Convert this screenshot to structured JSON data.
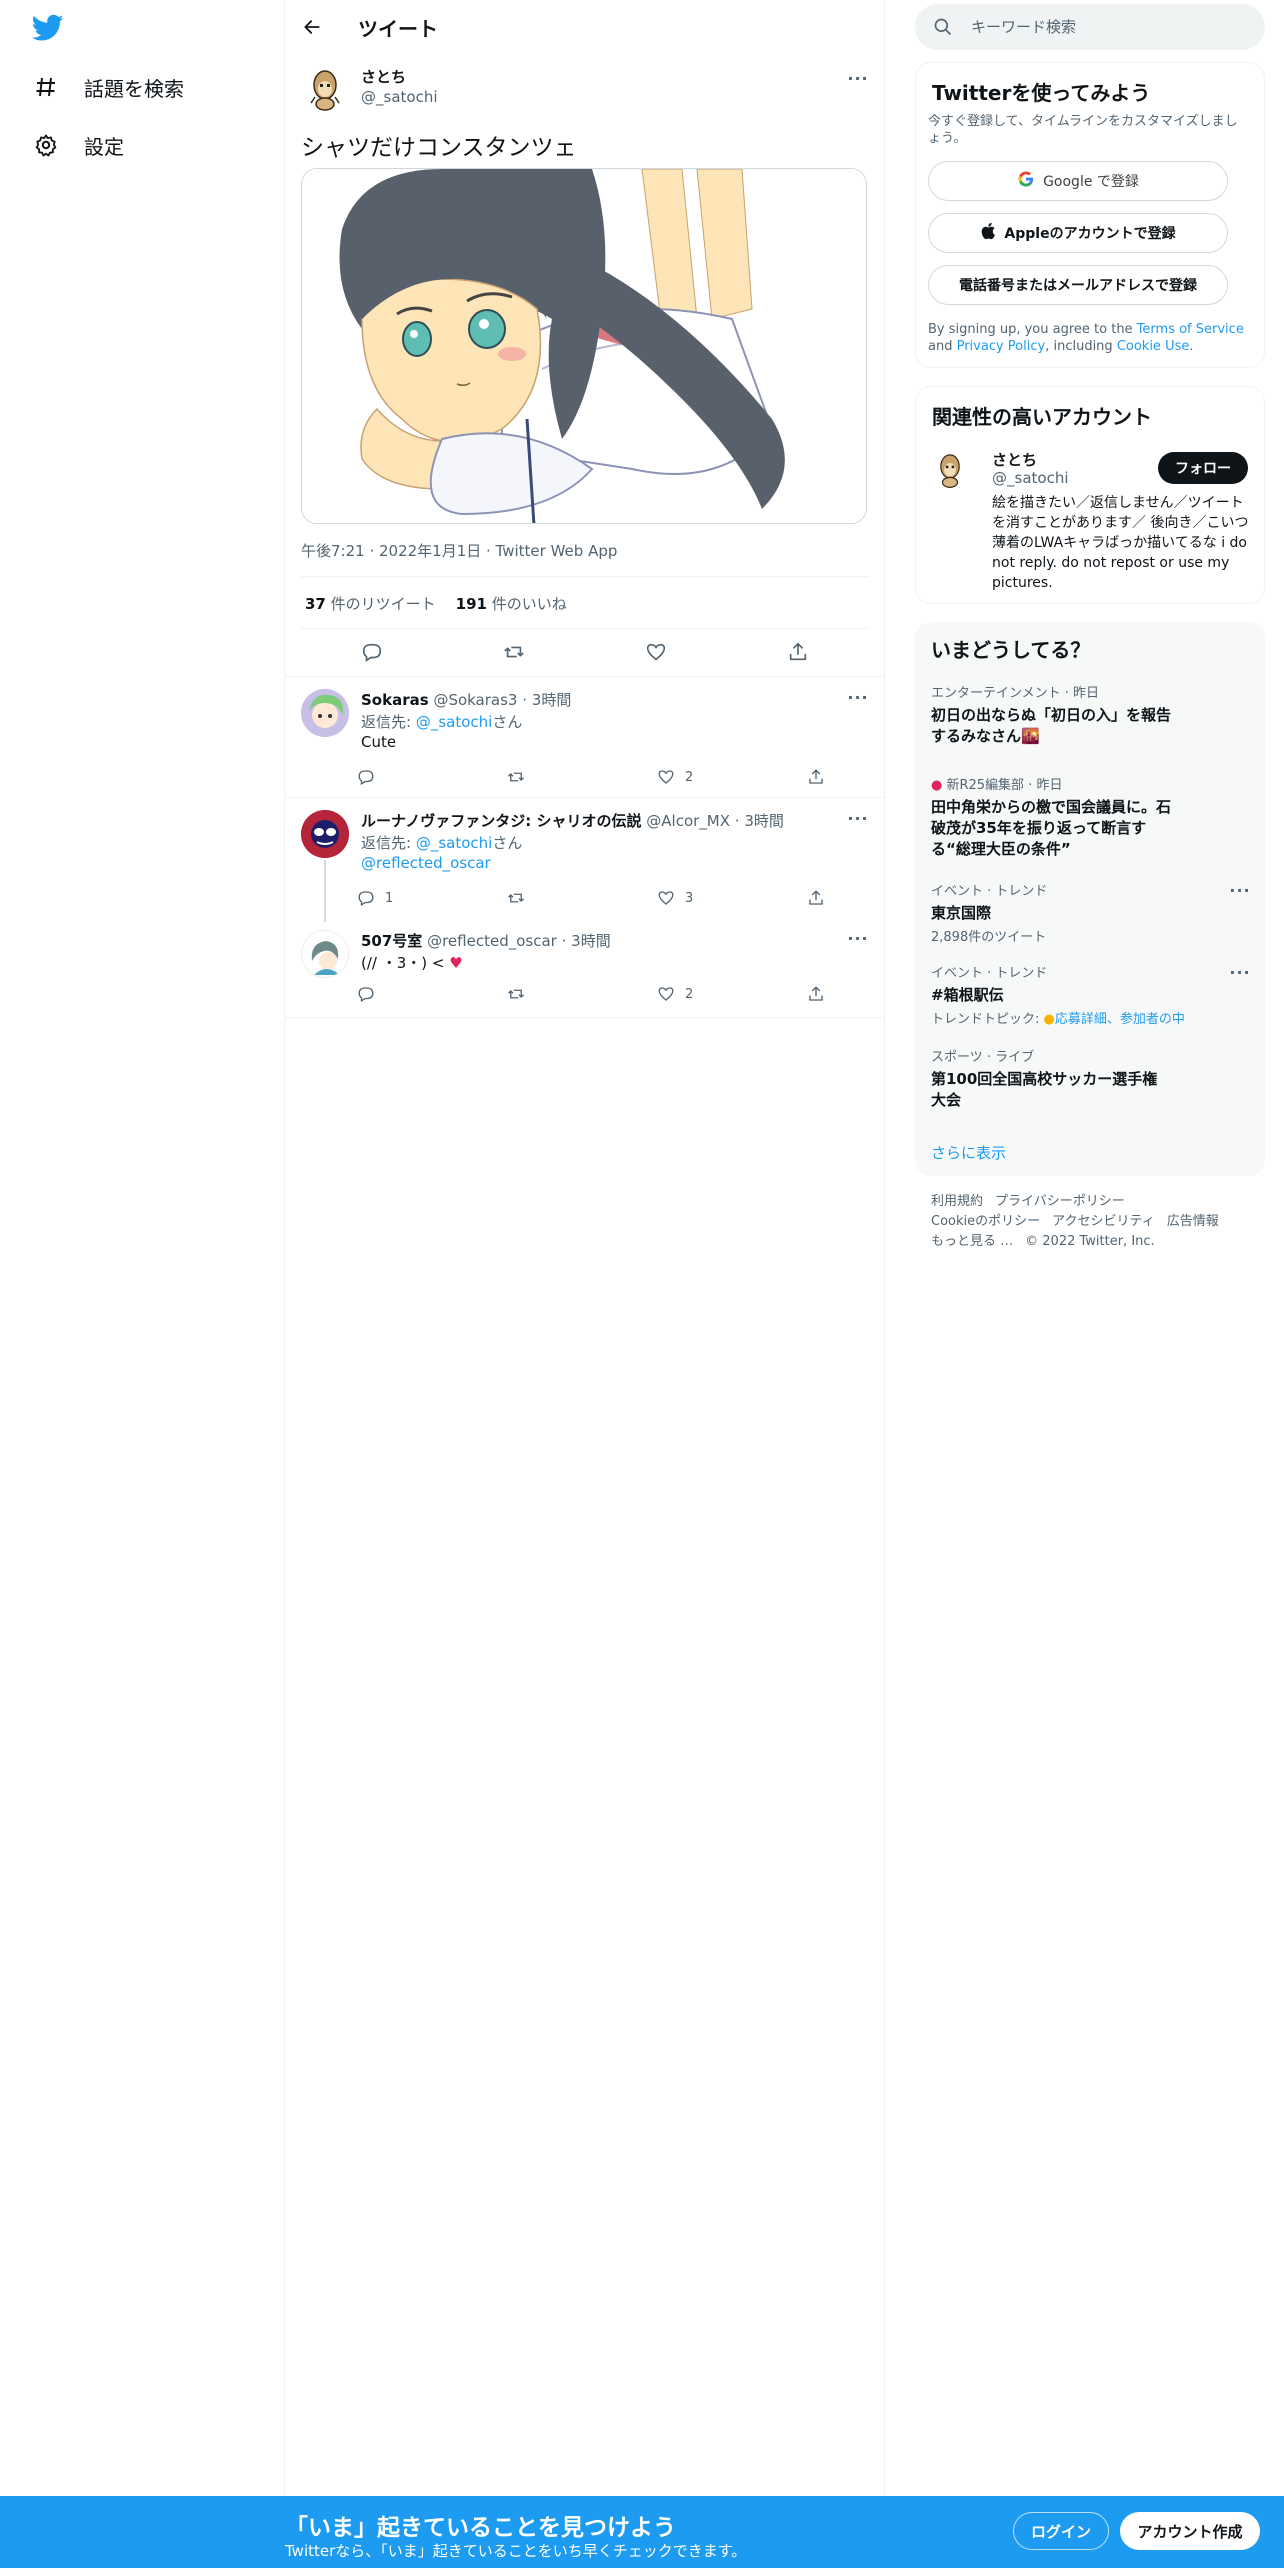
{
  "colors": {
    "brand": "#1d9bf0",
    "text": "#0f1419",
    "muted": "#536471",
    "like_red": "#f91880"
  },
  "nav": {
    "explore_label": "話題を検索",
    "settings_label": "設定"
  },
  "header": {
    "title": "ツイート"
  },
  "tweet": {
    "author_name": "さとち",
    "author_handle": "@_satochi",
    "text": "シャツだけコンスタンツェ",
    "meta": "午後7:21 · 2022年1月1日 · Twitter Web App",
    "retweets_count": "37",
    "retweets_label": "件のリツイート",
    "likes_count": "191",
    "likes_label": "件のいいね"
  },
  "replies": [
    {
      "name": "Sokaras",
      "handle": "@Sokaras3",
      "time": "· 3時間",
      "reply_to_prefix": "返信先: ",
      "reply_to": "@_satochi",
      "reply_to_suffix": "さん",
      "text": "Cute",
      "reply_count": "",
      "retweet_count": "",
      "like_count": "2"
    },
    {
      "name": "ルーナノヴァファンタジ: シャリオの伝説",
      "handle": "@Alcor_MX",
      "time": "· 3時間",
      "reply_to_prefix": "返信先: ",
      "reply_to": "@_satochi",
      "reply_to_suffix": "さん",
      "text": "@reflected_oscar",
      "reply_count": "1",
      "retweet_count": "",
      "like_count": "3"
    },
    {
      "name": "507号室",
      "handle": "@reflected_oscar",
      "time": "· 3時間",
      "text": "(// ・3・) < ",
      "reply_count": "",
      "retweet_count": "",
      "like_count": "2"
    }
  ],
  "search": {
    "placeholder": "キーワード検索"
  },
  "signup": {
    "title": "Twitterを使ってみよう",
    "subtitle": "今すぐ登録して、タイムラインをカスタマイズしましょう。",
    "google_label": "Google で登録",
    "apple_label": "Appleのアカウントで登録",
    "phone_label": "電話番号またはメールアドレスで登録",
    "terms_prefix": "By signing up, you agree to the ",
    "terms_link": "Terms of Service",
    "terms_and": " and ",
    "privacy_link": "Privacy Policy",
    "terms_including": ", including ",
    "cookie_link": "Cookie Use",
    "terms_end": "."
  },
  "relevant": {
    "title": "関連性の高いアカウント",
    "name": "さとち",
    "handle": "@_satochi",
    "follow_label": "フォロー",
    "bio": "絵を描きたい／返信しません／ツイートを消すことがあります／ 後向き／こいつ薄着のLWAキャラばっか描いてるな i do not reply. do not repost or use my pictures."
  },
  "trends": {
    "title": "いまどうしてる？",
    "items": [
      {
        "category": "エンターテインメント · 昨日",
        "title": "初日の出ならぬ「初日の入」を報告するみなさん🌇"
      },
      {
        "category": "新R25編集部 · 昨日",
        "title": "田中角栄からの檄で国会議員に。石破茂が35年を振り返って断言する“総理大臣の条件”"
      },
      {
        "category": "イベント · トレンド",
        "title": "東京国際",
        "sub": "2,898件のツイート"
      },
      {
        "category": "イベント · トレンド",
        "title": "#箱根駅伝",
        "sub_prefix": "トレンドトピック: ",
        "sub_link": "応募詳細、参加者の中"
      },
      {
        "category": "スポーツ · ライブ",
        "title": "第100回全国高校サッカー選手権大会"
      }
    ],
    "show_more": "さらに表示"
  },
  "footer": {
    "links": [
      "利用規約",
      "プライバシーポリシー",
      "Cookieのポリシー",
      "アクセシビリティ",
      "広告情報",
      "もっと見る …"
    ],
    "copyright": "© 2022 Twitter, Inc."
  },
  "bottom_bar": {
    "title": "「いま」起きていることを見つけよう",
    "subtitle": "Twitterなら、「いま」起きていることをいち早くチェックできます。",
    "login_label": "ログイン",
    "signup_label": "アカウント作成"
  }
}
